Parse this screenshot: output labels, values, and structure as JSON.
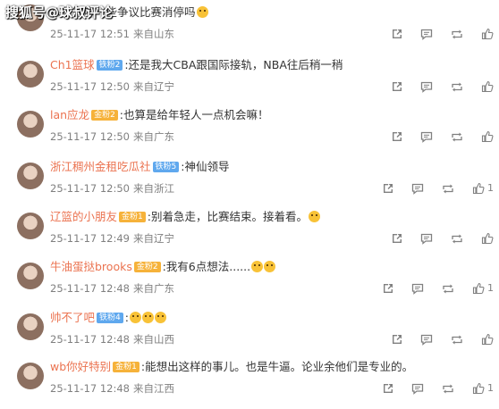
{
  "watermark": "搜狐号@球叔评论",
  "comments": [
    {
      "user": "",
      "badge": "",
      "text": "八分钟够一些争议比赛消停吗",
      "emojis": 1,
      "date": "25-11-17 12:51",
      "source": "来自山东",
      "likes": ""
    },
    {
      "user": "Ch1篮球",
      "badge": "铁粉2",
      "text": ":还是我大CBA跟国际接轨，NBA往后稍一稍",
      "emojis": 0,
      "date": "25-11-17 12:50",
      "source": "来自辽宁",
      "likes": ""
    },
    {
      "user": "lan应龙",
      "badge": "金粉2",
      "text": ":也算是给年轻人一点机会嘛！",
      "emojis": 0,
      "date": "25-11-17 12:50",
      "source": "来自广东",
      "likes": ""
    },
    {
      "user": "浙江稠州金租吃瓜社",
      "badge": "铁粉5",
      "text": ":神仙领导",
      "emojis": 0,
      "date": "25-11-17 12:50",
      "source": "来自浙江",
      "likes": "1"
    },
    {
      "user": "辽篮的小朋友",
      "badge": "金粉1",
      "text": ":别着急走，比赛结束。接着看。",
      "emojis": 1,
      "date": "25-11-17 12:49",
      "source": "来自辽宁",
      "likes": ""
    },
    {
      "user": "牛油蛋挞brooks",
      "badge": "金粉2",
      "text": ":我有6点想法......",
      "emojis": 2,
      "date": "25-11-17 12:48",
      "source": "来自广东",
      "likes": "1"
    },
    {
      "user": "帅不了吧",
      "badge": "铁粉4",
      "text": ":",
      "emojis": 3,
      "date": "25-11-17 12:48",
      "source": "来自山西",
      "likes": ""
    },
    {
      "user": "wb你好特别",
      "badge": "金粉1",
      "text": ":能想出这样的事儿。也是牛逼。论业余他们是专业的。",
      "emojis": 0,
      "date": "25-11-17 12:48",
      "source": "来自江西",
      "likes": "1"
    }
  ]
}
